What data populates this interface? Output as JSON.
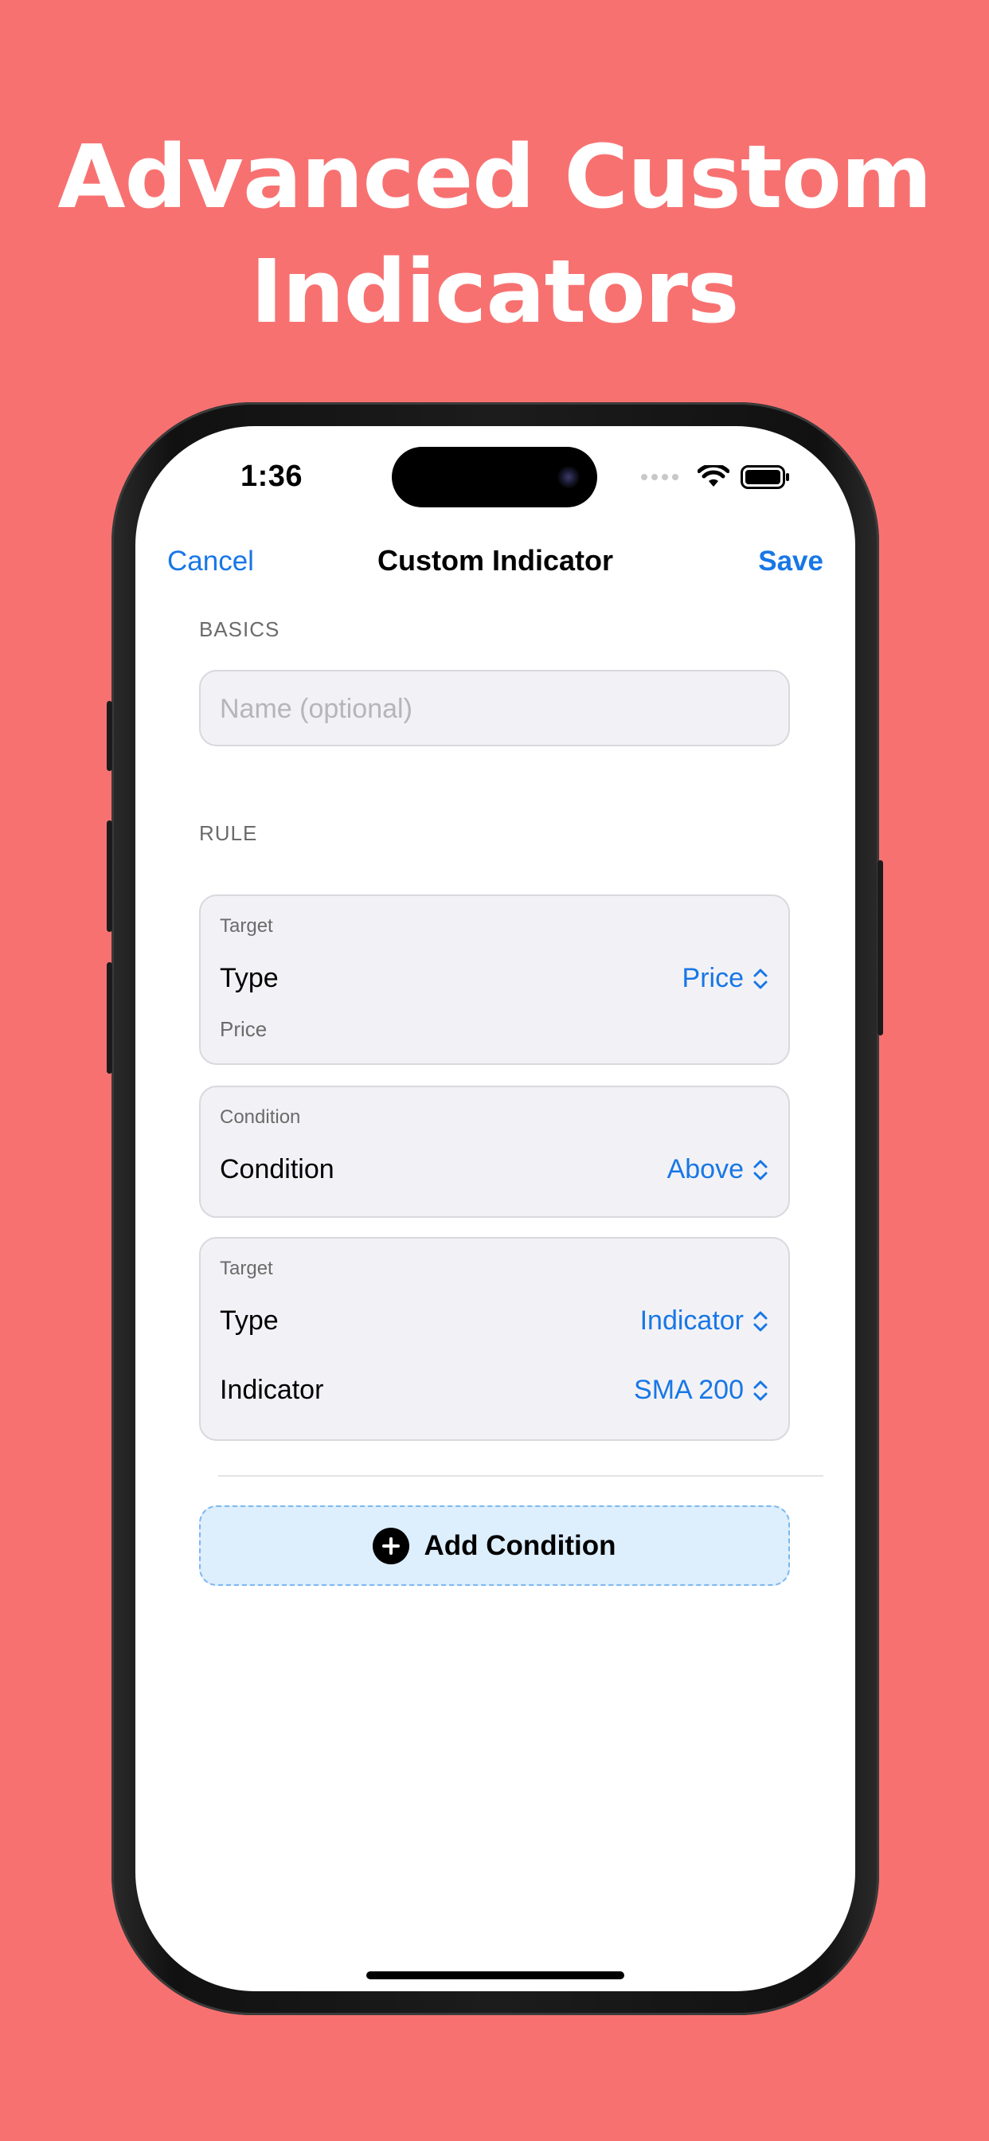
{
  "headline": {
    "line1": "Advanced Custom",
    "line2": "Indicators"
  },
  "status_bar": {
    "time": "1:36",
    "icons": [
      "signal-icon",
      "wifi-icon",
      "battery-icon"
    ]
  },
  "nav": {
    "cancel_label": "Cancel",
    "title": "Custom Indicator",
    "save_label": "Save"
  },
  "basics": {
    "section_label": "BASICS",
    "name_placeholder": "Name (optional)",
    "name_value": ""
  },
  "rule": {
    "section_label": "RULE",
    "target1": {
      "caption": "Target",
      "type_label": "Type",
      "type_value": "Price",
      "subtext": "Price"
    },
    "condition": {
      "caption": "Condition",
      "label": "Condition",
      "value": "Above"
    },
    "target2": {
      "caption": "Target",
      "type_label": "Type",
      "type_value": "Indicator",
      "indicator_label": "Indicator",
      "indicator_value": "SMA 200"
    }
  },
  "add_condition": {
    "label": "Add Condition"
  },
  "colors": {
    "background": "#F87171",
    "accent": "#1877E6",
    "card": "#F2F2F6",
    "add_button": "#DDEEFC"
  }
}
